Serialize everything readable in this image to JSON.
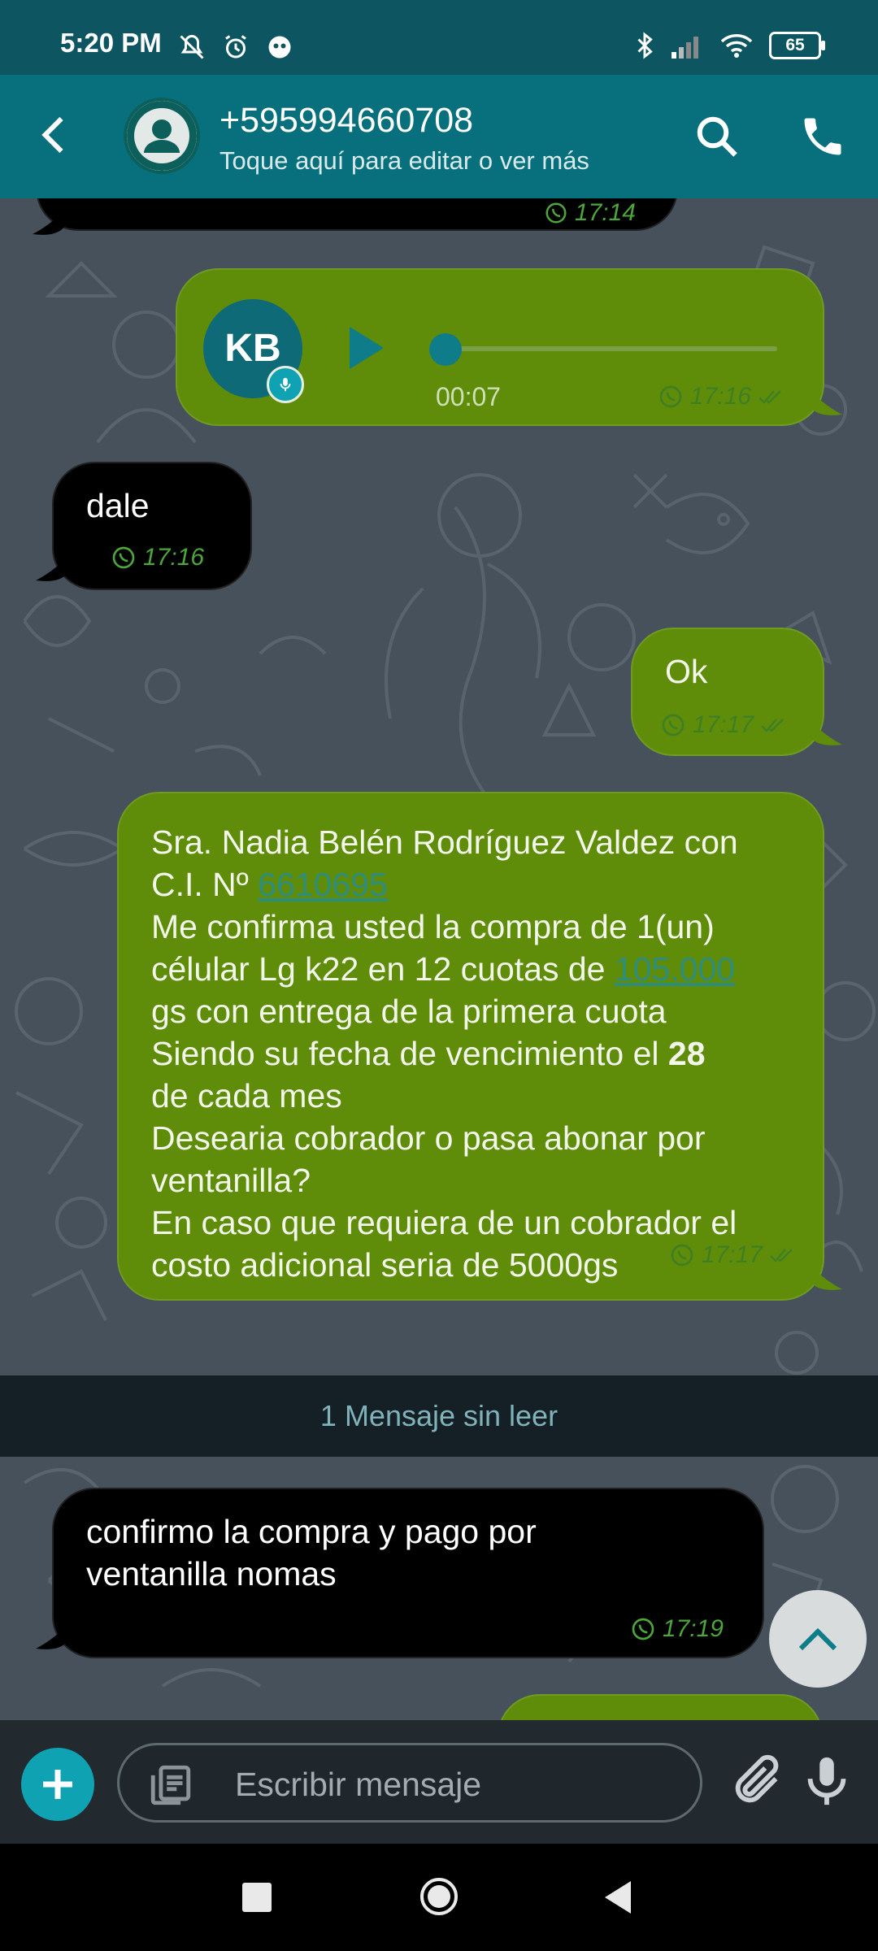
{
  "status_bar": {
    "time": "5:20 PM",
    "battery": "65"
  },
  "header": {
    "contact_name": "+595994660708",
    "subtitle": "Toque aquí para editar o ver más"
  },
  "messages": {
    "top_partial_time": "17:14",
    "voice": {
      "avatar_initials": "KB",
      "duration": "00:07",
      "time": "17:16"
    },
    "dale": {
      "text": "dale",
      "time": "17:16"
    },
    "ok": {
      "text": "Ok",
      "time": "17:17"
    },
    "long": {
      "line1": "Sra. Nadia Belén Rodríguez  Valdez con",
      "line2_prefix": "C.I. Nº ",
      "line2_link": "6610695",
      "line3": "Me confirma usted la compra de 1(un)",
      "line4_prefix": "célular Lg k22 en 12 cuotas de ",
      "line4_link": "105.000",
      "line5": "gs con entrega de la primera cuota",
      "line6_prefix": "Siendo su fecha de vencimiento el ",
      "line6_bold": "28",
      "line7": "de cada mes",
      "line8": "Desearia cobrador o pasa abonar por",
      "line9": "ventanilla?",
      "line10": "En caso que requiera de un cobrador el",
      "line11": "costo adicional seria de 5000gs",
      "time": "17:17"
    },
    "unread_label": "1 Mensaje sin leer",
    "confirm": {
      "line1": "confirmo la compra y pago por",
      "line2": "ventanilla nomas",
      "time": "17:19"
    }
  },
  "input": {
    "placeholder": "Escribir mensaje"
  },
  "colors": {
    "header": "#08707d",
    "status_bar": "#0d5560",
    "outgoing_bubble": "#5f8d0a",
    "incoming_bubble": "#000000",
    "accent": "#0fa2b3"
  }
}
